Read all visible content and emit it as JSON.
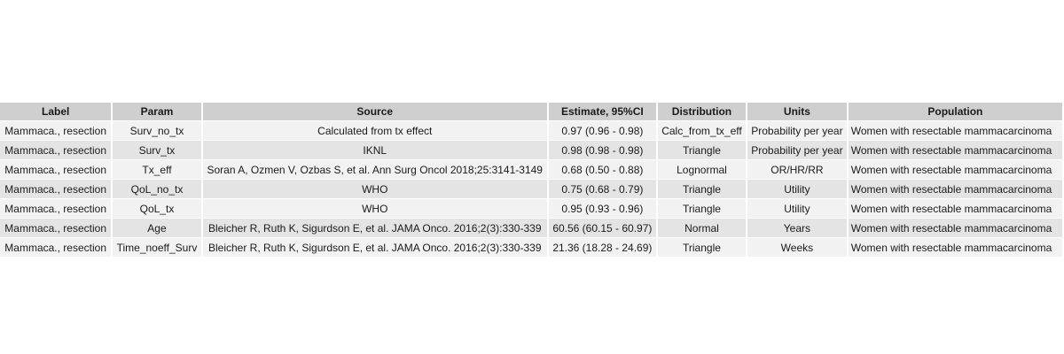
{
  "table": {
    "headers": [
      "Label",
      "Param",
      "Source",
      "Estimate, 95%CI",
      "Distribution",
      "Units",
      "Population"
    ],
    "rows": [
      [
        "Mammaca., resection",
        "Surv_no_tx",
        "Calculated from tx effect",
        "0.97 (0.96 - 0.98)",
        "Calc_from_tx_eff",
        "Probability per year",
        "Women with resectable mammacarcinoma"
      ],
      [
        "Mammaca., resection",
        "Surv_tx",
        "IKNL",
        "0.98 (0.98 - 0.98)",
        "Triangle",
        "Probability per year",
        "Women with resectable mammacarcinoma"
      ],
      [
        "Mammaca., resection",
        "Tx_eff",
        "Soran A, Ozmen V, Ozbas S, et al. Ann Surg Oncol 2018;25:3141-3149",
        "0.68 (0.50 - 0.88)",
        "Lognormal",
        "OR/HR/RR",
        "Women with resectable mammacarcinoma"
      ],
      [
        "Mammaca., resection",
        "QoL_no_tx",
        "WHO",
        "0.75 (0.68 - 0.79)",
        "Triangle",
        "Utility",
        "Women with resectable mammacarcinoma"
      ],
      [
        "Mammaca., resection",
        "QoL_tx",
        "WHO",
        "0.95 (0.93 - 0.96)",
        "Triangle",
        "Utility",
        "Women with resectable mammacarcinoma"
      ],
      [
        "Mammaca., resection",
        "Age",
        "Bleicher R, Ruth K, Sigurdson E, et al. JAMA Onco. 2016;2(3):330-339",
        "60.56 (60.15 - 60.97)",
        "Normal",
        "Years",
        "Women with resectable mammacarcinoma"
      ],
      [
        "Mammaca., resection",
        "Time_noeff_Surv",
        "Bleicher R, Ruth K, Sigurdson E, et al. JAMA Onco. 2016;2(3):330-339",
        "21.36 (18.28 - 24.69)",
        "Triangle",
        "Weeks",
        "Women with resectable mammacarcinoma"
      ]
    ]
  }
}
